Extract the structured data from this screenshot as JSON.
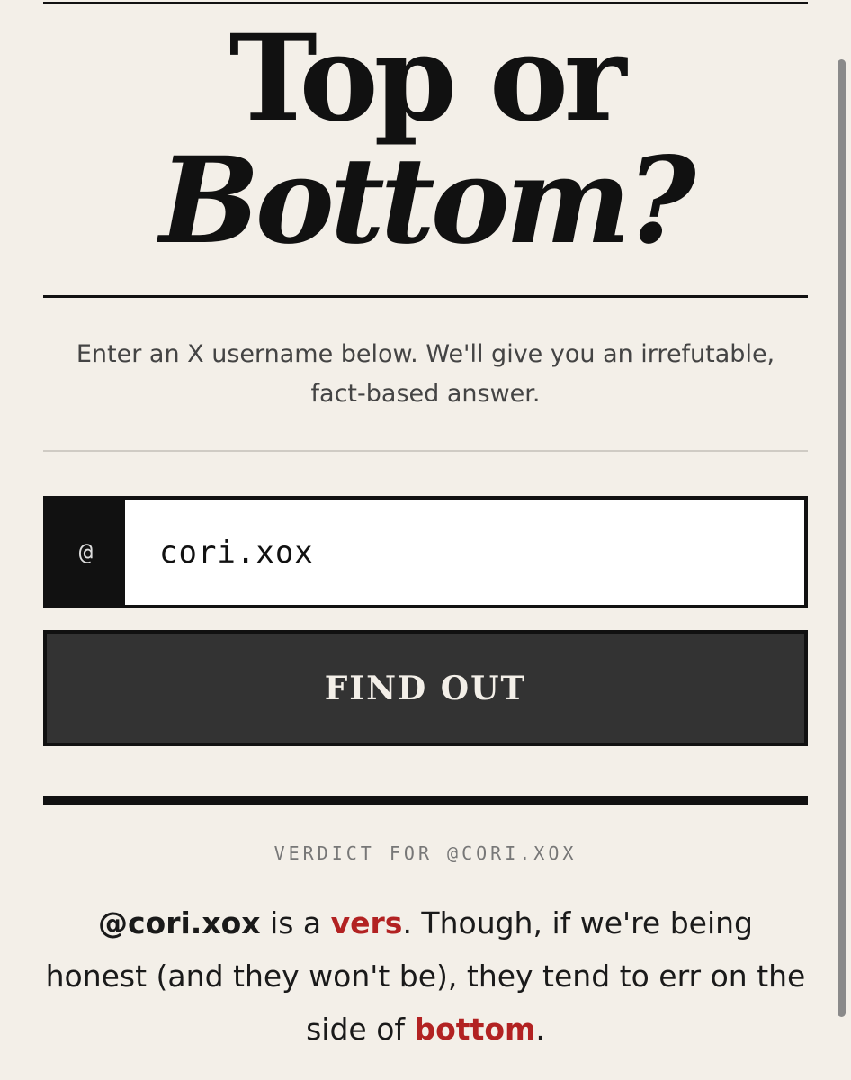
{
  "title": {
    "line1": "Top or",
    "line2": "Bottom?"
  },
  "intro": {
    "text": "Enter an X username below. We'll give you an irrefutable, fact-based answer."
  },
  "form": {
    "at_symbol": "@",
    "username_value": "cori.xox",
    "button_label": "FIND OUT"
  },
  "verdict": {
    "label": "VERDICT FOR @CORI.XOX",
    "handle": "@cori.xox",
    "text1": " is a ",
    "result": "vers",
    "text2": ". Though, if we're being honest (and they won't be), they tend to err on the side of ",
    "lean": "bottom",
    "text3": "."
  },
  "colors": {
    "background": "#f3efe8",
    "ink": "#111111",
    "button": "#333333",
    "accent_red": "#b22222"
  }
}
